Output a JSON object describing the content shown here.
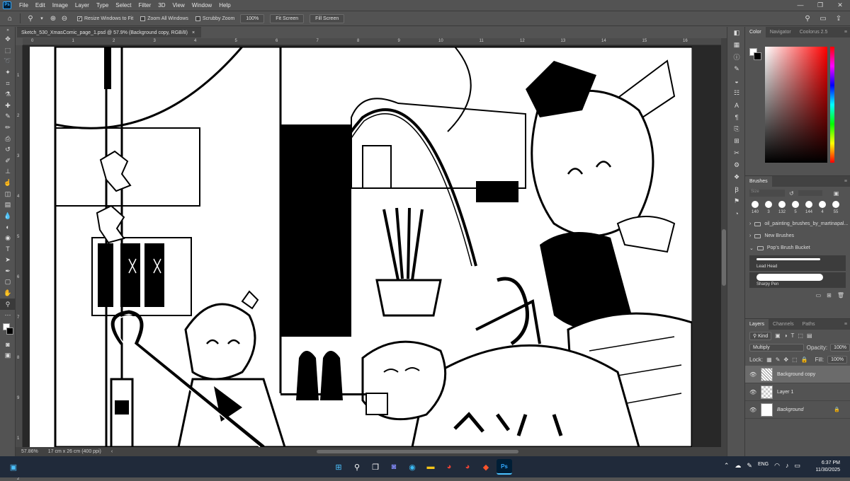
{
  "app": {
    "logo": "Ps"
  },
  "menu": [
    "File",
    "Edit",
    "Image",
    "Layer",
    "Type",
    "Select",
    "Filter",
    "3D",
    "View",
    "Window",
    "Help"
  ],
  "window_controls": [
    "—",
    "❐",
    "✕"
  ],
  "options": {
    "resize_windows": "Resize Windows to Fit",
    "zoom_all": "Zoom All Windows",
    "scrubby_zoom": "Scrubby Zoom",
    "zoom_pct": "100%",
    "fit_screen": "Fit Screen",
    "fill_screen": "Fill Screen"
  },
  "document": {
    "tab_title": "Sketch_530_XmasComic_page_1.psd @ 57.9% (Background copy, RGB/8)",
    "close": "×"
  },
  "ruler_h": [
    "0",
    "1",
    "2",
    "3",
    "4",
    "5",
    "6",
    "7",
    "8",
    "9",
    "10",
    "11",
    "12",
    "13",
    "14",
    "15",
    "16"
  ],
  "ruler_v": [
    "1",
    "2",
    "3",
    "4",
    "5",
    "6",
    "7",
    "8",
    "9",
    "1",
    "2"
  ],
  "status": {
    "zoom": "57.86%",
    "doc_size": "17 cm x 26 cm (400 ppi)"
  },
  "color_panel": {
    "tabs": [
      "Color",
      "Navigator",
      "Coolorus 2.5"
    ]
  },
  "brushes": {
    "title": "Brushes",
    "size_placeholder": "Size",
    "presets": [
      "140",
      "3",
      "132",
      "5",
      "144",
      "4",
      "55"
    ],
    "folders": [
      "oil_painting_brushes_by_martinapal...",
      "New Brushes",
      "Pop's Brush Bucket"
    ],
    "brush_names": [
      "Lead Head",
      "Sharpy Pen"
    ]
  },
  "layers": {
    "tabs": [
      "Layers",
      "Channels",
      "Paths"
    ],
    "kind": "Kind",
    "blend_mode": "Multiply",
    "opacity_label": "Opacity:",
    "opacity": "100%",
    "lock_label": "Lock:",
    "fill_label": "Fill:",
    "fill": "100%",
    "items": [
      {
        "name": "Background copy"
      },
      {
        "name": "Layer 1"
      },
      {
        "name": "Background"
      }
    ]
  },
  "taskbar": {
    "tray": "ENG",
    "time": "6:37 PM",
    "date": "11/30/2025"
  }
}
